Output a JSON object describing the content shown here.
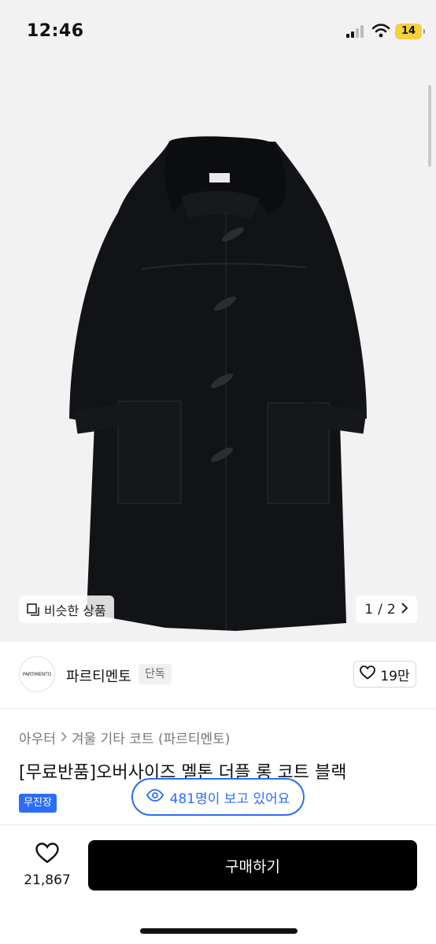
{
  "status_bar": {
    "time": "12:46",
    "battery": "14"
  },
  "gallery": {
    "similar_label": "비슷한 상품",
    "page_current": "1",
    "page_separator": "/",
    "page_total": "2"
  },
  "seller": {
    "avatar_text": "PARTIMENTO",
    "name": "파르티멘토",
    "badge": "단독",
    "likes": "19만"
  },
  "breadcrumb": {
    "category": "아우터",
    "subcategory": "겨울 기타 코트 (파르티멘토)"
  },
  "product": {
    "title": "[무료반품]오버사이즈 멜톤 더플 롱 코트 블랙",
    "tag": "무진장"
  },
  "viewers": {
    "text": "481명이 보고 있어요"
  },
  "bottom_bar": {
    "wish_count": "21,867",
    "buy_label": "구매하기"
  },
  "colors": {
    "accent": "#2d6df6",
    "buy_button": "#000000",
    "coat": "#111317",
    "hero_bg": "#f2f2f2"
  }
}
